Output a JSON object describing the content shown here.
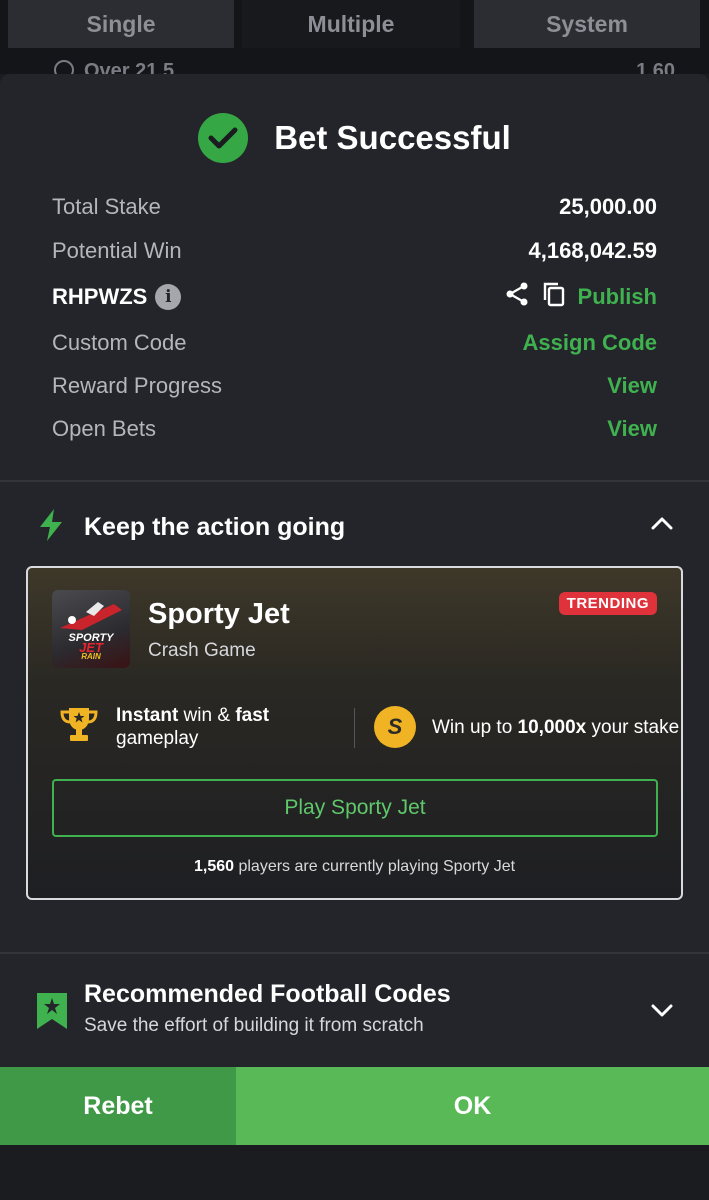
{
  "tabs": [
    {
      "label": "Single"
    },
    {
      "label": "Multiple"
    },
    {
      "label": "System"
    }
  ],
  "peek": {
    "label": "Over 21.5",
    "odds": "1.60"
  },
  "success": {
    "title": "Bet Successful"
  },
  "summary": {
    "total_stake_label": "Total Stake",
    "total_stake_value": "25,000.00",
    "potential_win_label": "Potential Win",
    "potential_win_value": "4,168,042.59",
    "booking_code": "RHPWZS",
    "publish_label": "Publish",
    "custom_code_label": "Custom Code",
    "assign_code_label": "Assign Code",
    "reward_progress_label": "Reward Progress",
    "reward_progress_link": "View",
    "open_bets_label": "Open Bets",
    "open_bets_link": "View"
  },
  "action_section": {
    "title": "Keep the action going"
  },
  "game_card": {
    "name": "Sporty Jet",
    "type": "Crash Game",
    "badge": "TRENDING",
    "thumb_line1": "SPORTY",
    "thumb_line2": "JET",
    "thumb_line3": "RAIN",
    "feature1_bold1": "Instant",
    "feature1_mid": " win & ",
    "feature1_bold2": "fast",
    "feature1_end": " gameplay",
    "feature2_start": "Win up to ",
    "feature2_bold": "10,000x",
    "feature2_end": " your stake",
    "play_label": "Play Sporty Jet",
    "players_count": "1,560",
    "players_text": " players are currently playing Sporty Jet"
  },
  "recommended": {
    "title": "Recommended Football Codes",
    "subtitle": "Save the effort of building it from scratch"
  },
  "buttons": {
    "rebet": "Rebet",
    "ok": "OK"
  },
  "colors": {
    "accent": "#3fb14f",
    "trending": "#e0323a",
    "ok": "#59b957",
    "rebet": "#3f9947"
  }
}
